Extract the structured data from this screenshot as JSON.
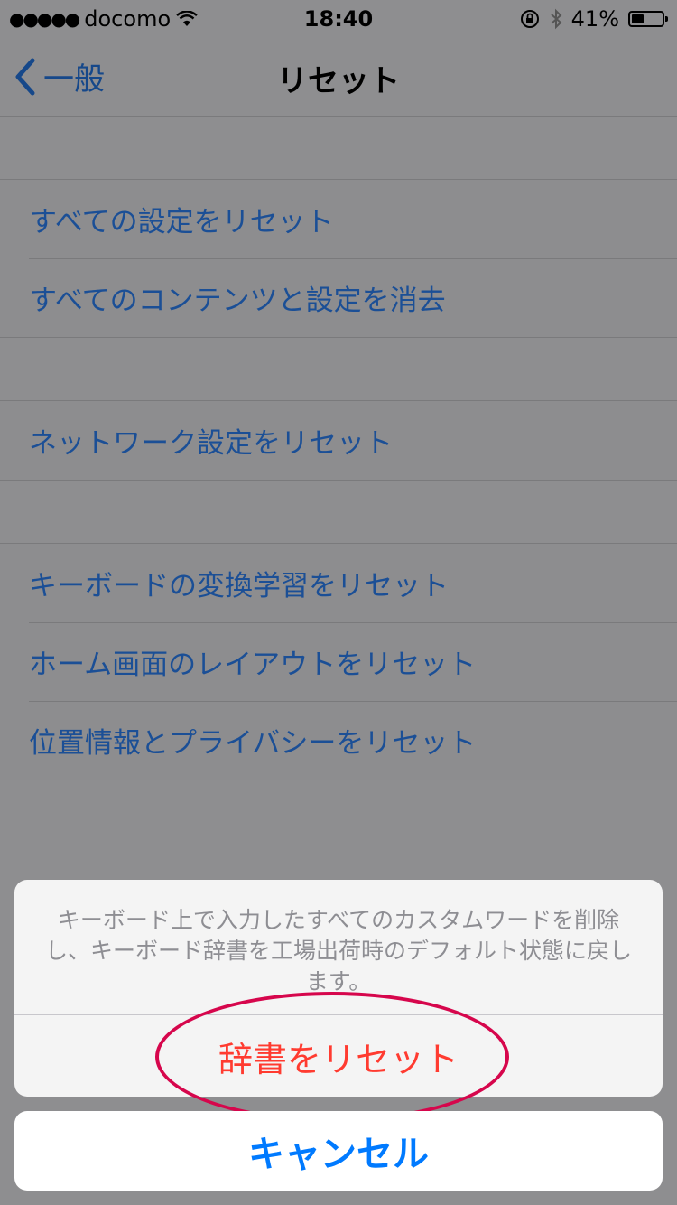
{
  "status_bar": {
    "carrier": "docomo",
    "time": "18:40",
    "battery": "41%",
    "battery_level": 0.41
  },
  "nav": {
    "back_label": "一般",
    "title": "リセット"
  },
  "groups": [
    {
      "items": [
        "すべての設定をリセット",
        "すべてのコンテンツと設定を消去"
      ]
    },
    {
      "items": [
        "ネットワーク設定をリセット"
      ]
    },
    {
      "items": [
        "キーボードの変換学習をリセット",
        "ホーム画面のレイアウトをリセット",
        "位置情報とプライバシーをリセット"
      ]
    }
  ],
  "action_sheet": {
    "message": "キーボード上で入力したすべてのカスタムワードを削除し、キーボード辞書を工場出荷時のデフォルト状態に戻します。",
    "destructive_label": "辞書をリセット",
    "cancel_label": "キャンセル"
  },
  "colors": {
    "link_blue": "#1b4f96",
    "destructive_red": "#ff3b30",
    "annotation_circle": "#d6064c",
    "cancel_blue": "#007aff"
  }
}
